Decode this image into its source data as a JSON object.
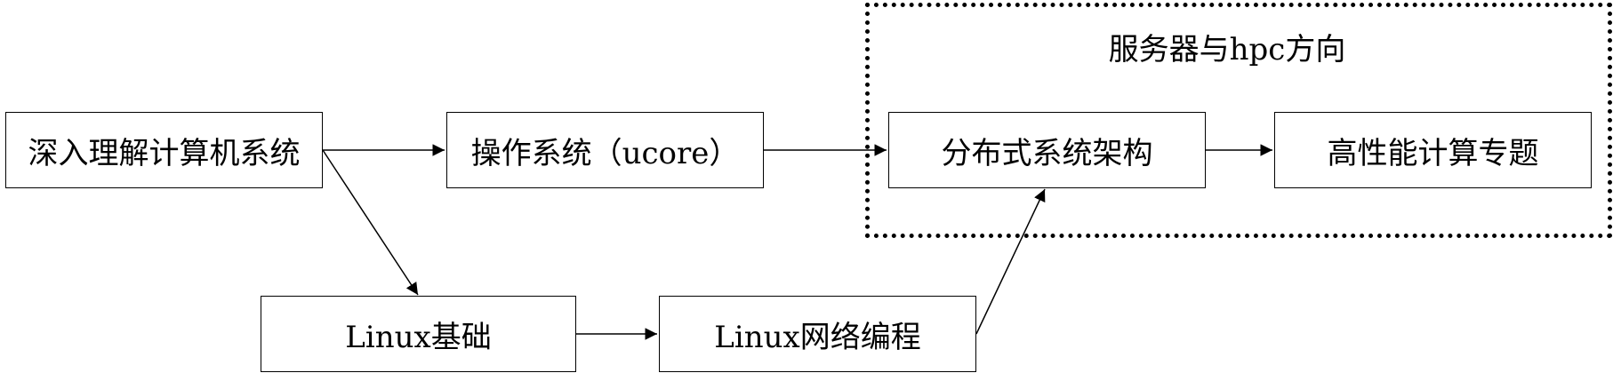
{
  "group": {
    "title": "服务器与hpc方向"
  },
  "nodes": {
    "deep_csapp": "深入理解计算机系统",
    "os_ucore": "操作系统（ucore）",
    "distributed": "分布式系统架构",
    "hpc": "高性能计算专题",
    "linux_basics": "Linux基础",
    "linux_net": "Linux网络编程"
  },
  "edges": [
    {
      "from": "deep_csapp",
      "to": "os_ucore"
    },
    {
      "from": "deep_csapp",
      "to": "linux_basics"
    },
    {
      "from": "os_ucore",
      "to": "distributed"
    },
    {
      "from": "distributed",
      "to": "hpc"
    },
    {
      "from": "linux_basics",
      "to": "linux_net"
    },
    {
      "from": "linux_net",
      "to": "distributed"
    }
  ]
}
